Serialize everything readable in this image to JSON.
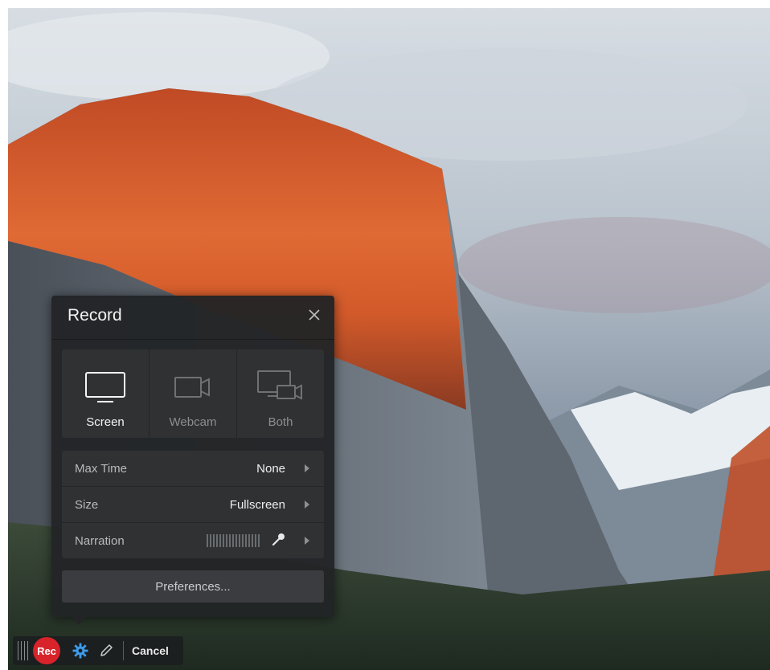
{
  "panel": {
    "title": "Record",
    "modes": [
      {
        "label": "Screen",
        "icon": "monitor-icon",
        "active": true
      },
      {
        "label": "Webcam",
        "icon": "webcam-icon",
        "active": false
      },
      {
        "label": "Both",
        "icon": "screen-and-webcam-icon",
        "active": false
      }
    ],
    "settings": [
      {
        "label": "Max Time",
        "value": "None"
      },
      {
        "label": "Size",
        "value": "Fullscreen"
      },
      {
        "label": "Narration",
        "value": ""
      }
    ],
    "preferences_label": "Preferences..."
  },
  "toolbar": {
    "rec_label": "Rec",
    "cancel_label": "Cancel"
  },
  "colors": {
    "rec_red": "#d8232a",
    "gear_blue": "#3d9be9",
    "panel_bg": "#222426"
  }
}
